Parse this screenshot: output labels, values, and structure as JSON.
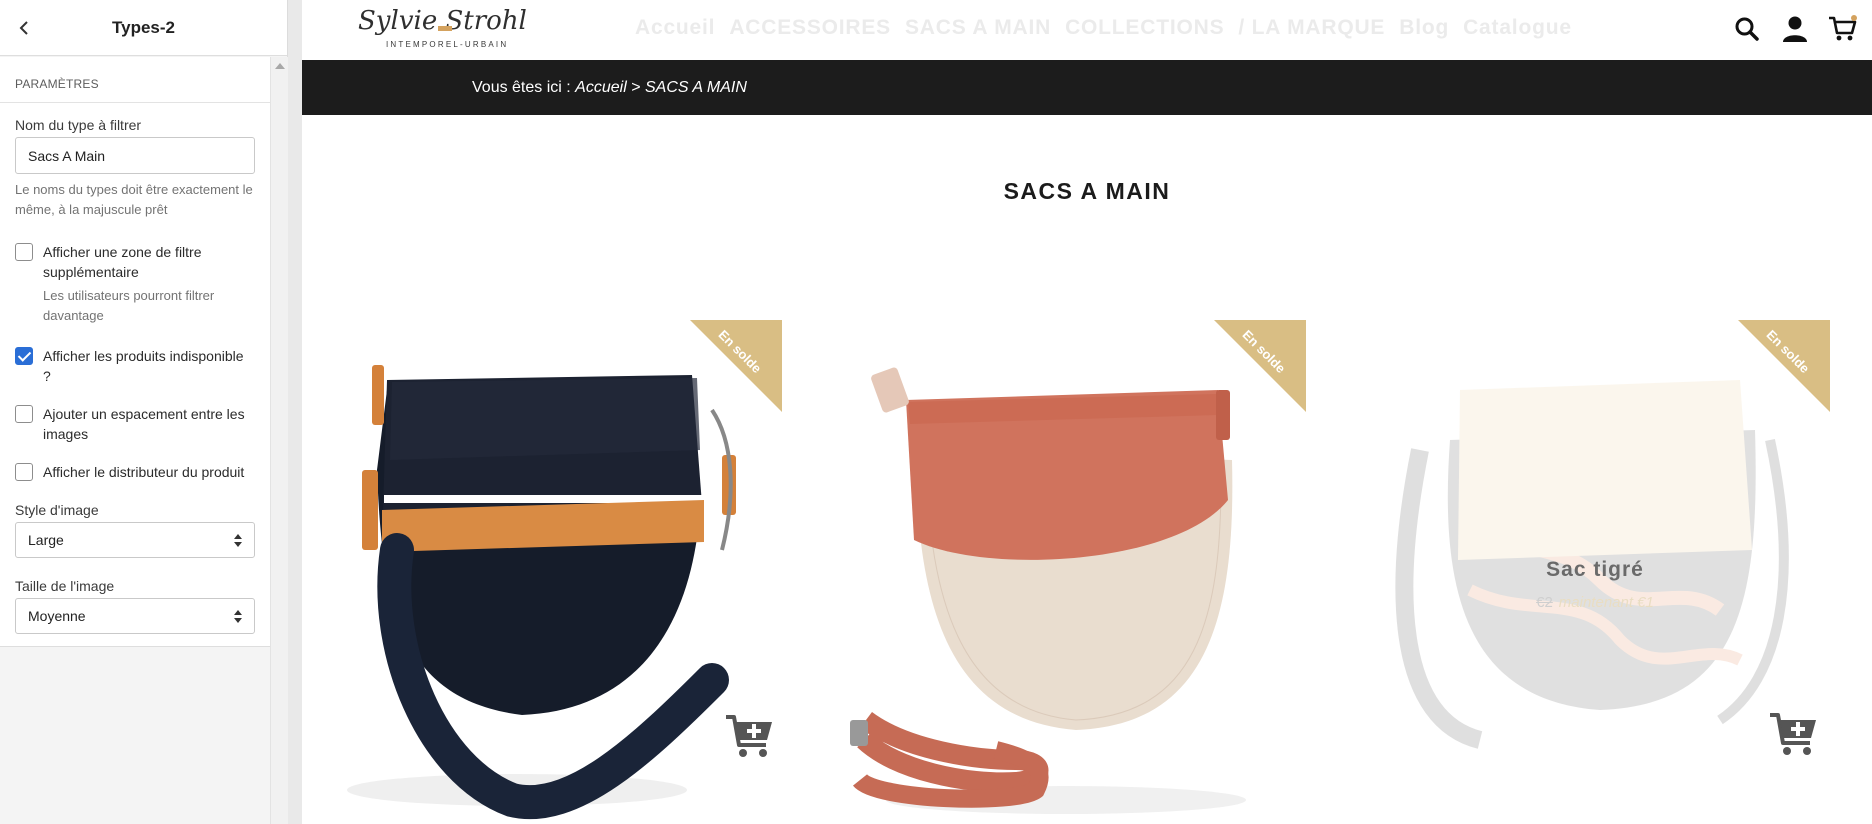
{
  "editor": {
    "title": "Types-2",
    "section": "PARAMÈTRES",
    "filter_name_label": "Nom du type à filtrer",
    "filter_name_value": "Sacs A Main",
    "filter_name_help": "Le noms du types doit être exactement le même, à la majuscule prêt",
    "checkboxes": [
      {
        "label": "Afficher une zone de filtre supplémentaire",
        "help": "Les utilisateurs pourront filtrer davantage",
        "checked": false
      },
      {
        "label": "Afficher les produits indisponible ?",
        "checked": true
      },
      {
        "label": "Ajouter un espacement entre les images",
        "checked": false
      },
      {
        "label": "Afficher le distributeur du produit",
        "checked": false
      }
    ],
    "image_style_label": "Style d'image",
    "image_style_value": "Large",
    "image_size_label": "Taille de l'image",
    "image_size_value": "Moyenne"
  },
  "store": {
    "logo_script": "Sylvie Strohl",
    "logo_sub": "INTEMPOREL-URBAIN",
    "menu": [
      "Accueil",
      "ACCESSOIRES",
      "SACS A MAIN",
      "COLLECTIONS",
      "/ LA MARQUE",
      "Blog",
      "Catalogue"
    ],
    "breadcrumb_prefix": "Vous êtes ici : ",
    "breadcrumb_home": "Accueil",
    "breadcrumb_sep": " > ",
    "breadcrumb_current": "SACS A MAIN",
    "page_title": "SACS A MAIN",
    "sale_badge": "En solde",
    "badge_color": "#d9be84",
    "products": [
      {
        "name": "",
        "bag": "black-leather-messenger"
      },
      {
        "name": "",
        "bag": "terracotta-linen-messenger"
      },
      {
        "name": "Sac tigré",
        "old_price": "€2",
        "new_price": "maintenant €1",
        "bag": "tiger-print-messenger",
        "hovered": true
      }
    ]
  }
}
